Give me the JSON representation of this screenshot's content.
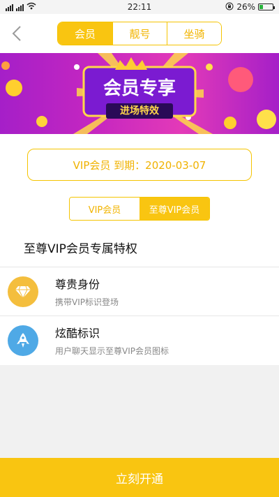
{
  "status": {
    "carrier_left": "4G",
    "carrier_right": "2G",
    "time": "22:11",
    "battery_text": "26%",
    "battery_level": 0.26
  },
  "nav": {
    "tabs": [
      {
        "label": "会员",
        "active": true
      },
      {
        "label": "靓号",
        "active": false
      },
      {
        "label": "坐骑",
        "active": false
      }
    ]
  },
  "banner": {
    "title": "会员专享",
    "subtitle": "进场特效"
  },
  "membership": {
    "expire_text": "VIP会员 到期：2020-03-07",
    "tiers": [
      {
        "label": "VIP会员",
        "active": false
      },
      {
        "label": "至尊VIP会员",
        "active": true
      }
    ],
    "section_title": "至尊VIP会员专属特权"
  },
  "features": [
    {
      "title": "尊贵身份",
      "subtitle": "携带VIP标识登场",
      "icon": "diamond-icon",
      "color": "#f4be3d"
    },
    {
      "title": "炫酷标识",
      "subtitle": "用户聊天显示至尊VIP会员图标",
      "icon": "rocket-icon",
      "color": "#4fa9e6"
    }
  ],
  "cta": {
    "label": "立刻开通"
  }
}
